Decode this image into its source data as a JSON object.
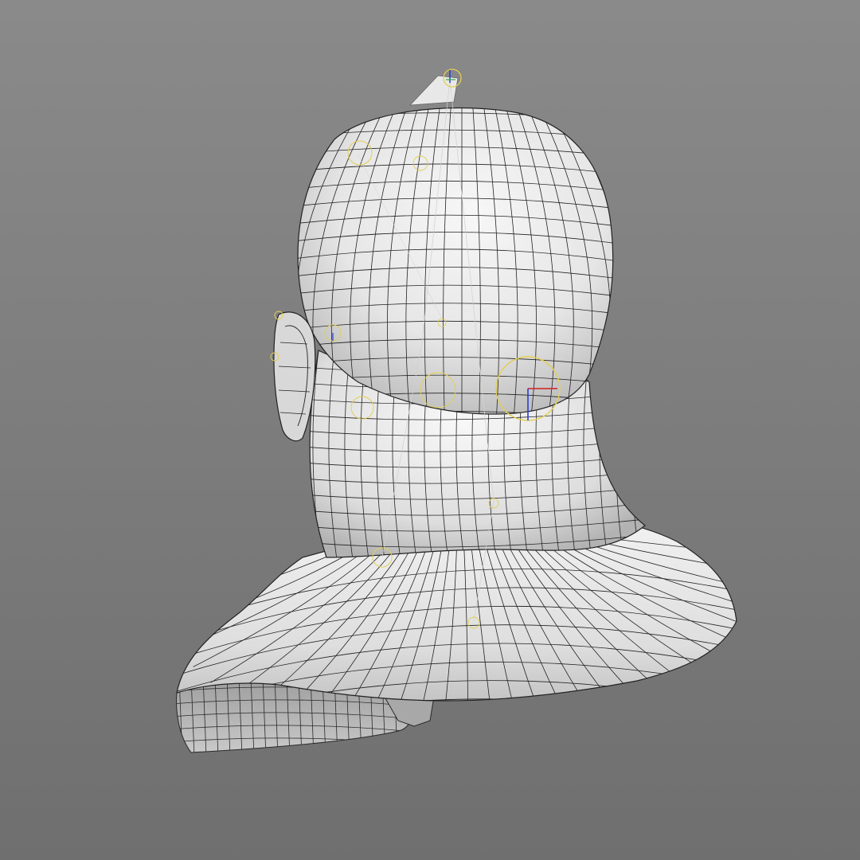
{
  "viewport": {
    "background_top": "#8a8a8a",
    "background_bottom": "#6f6f6f"
  },
  "model": {
    "surface_color": "#ececec",
    "shade_color": "#b8b8b8",
    "wire_color": "#1f1f1f",
    "rig_color": "#e2cf52",
    "axis_x_color": "#d22020",
    "axis_y_color": "#2a3fd0",
    "axis_z_color": "#2faa3a"
  }
}
